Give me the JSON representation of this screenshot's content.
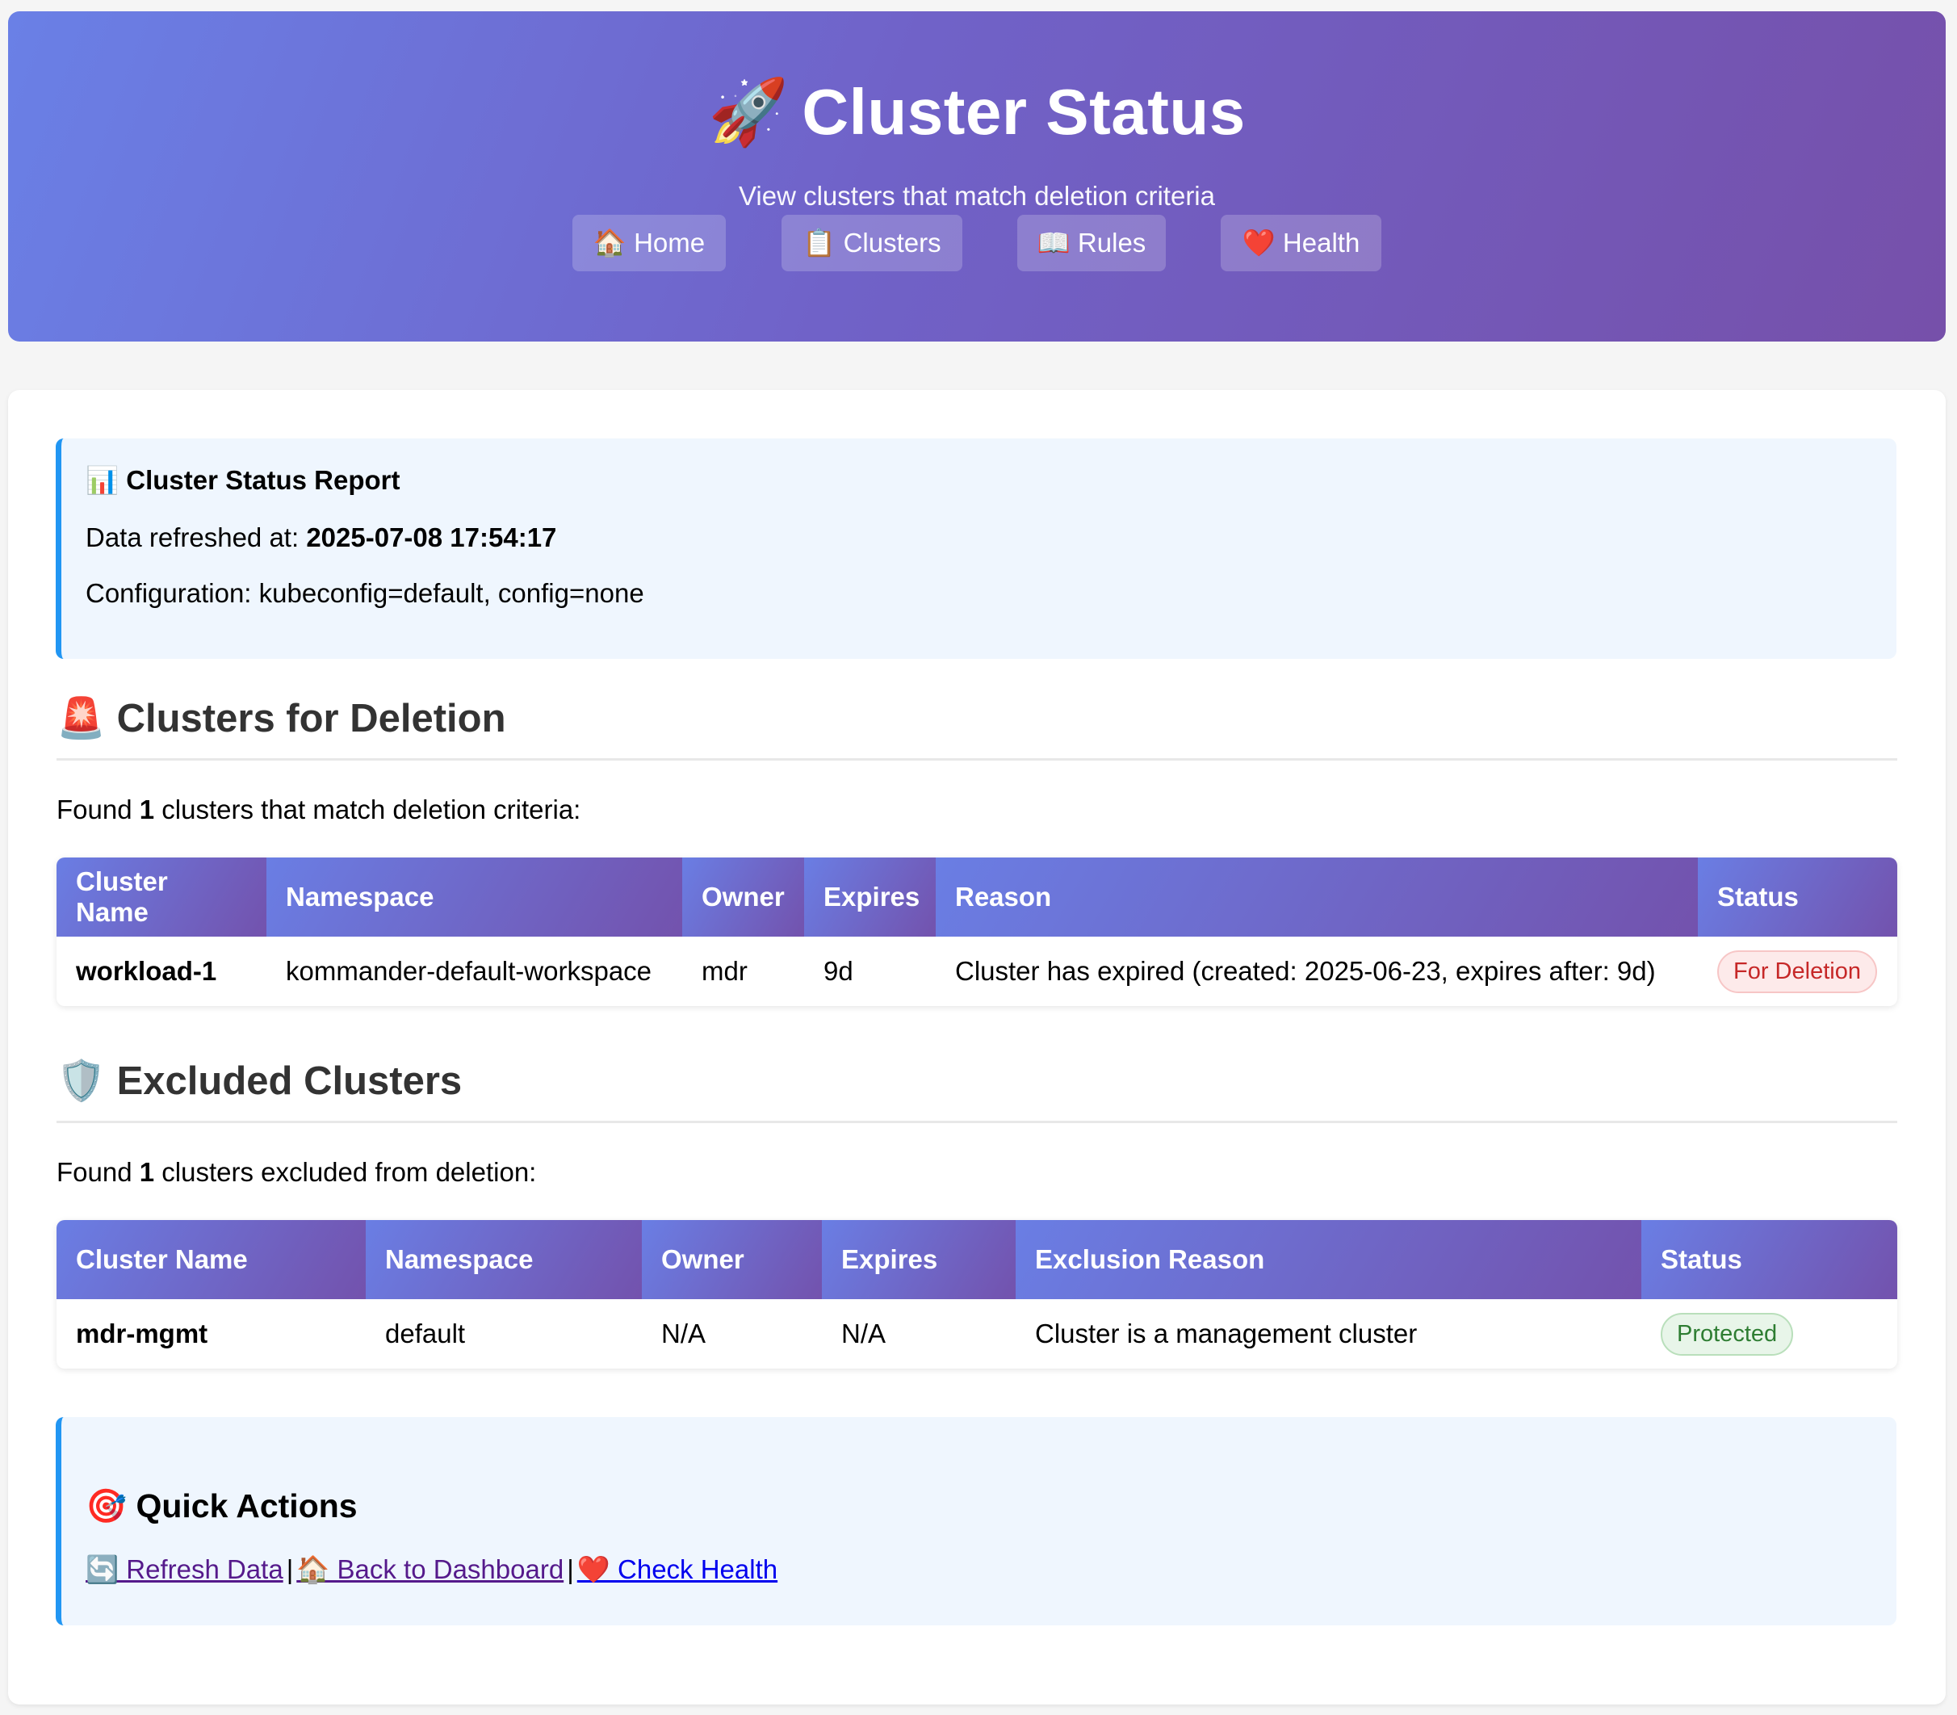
{
  "header": {
    "emoji": "🚀",
    "title": "Cluster Status",
    "subtitle": "View clusters that match deletion criteria",
    "nav": [
      {
        "label": "🏠 Home"
      },
      {
        "label": "📋 Clusters"
      },
      {
        "label": "📖 Rules"
      },
      {
        "label": "❤️ Health"
      }
    ]
  },
  "report": {
    "title": "📊 Cluster Status Report",
    "refreshed_label": "Data refreshed at:",
    "refreshed_value": "2025-07-08 17:54:17",
    "configuration": "Configuration: kubeconfig=default, config=none"
  },
  "deletion": {
    "title": "🚨 Clusters for Deletion",
    "found_prefix": "Found",
    "found_count": "1",
    "found_suffix": "clusters that match deletion criteria:",
    "columns": [
      "Cluster Name",
      "Namespace",
      "Owner",
      "Expires",
      "Reason",
      "Status"
    ],
    "rows": [
      {
        "name": "workload-1",
        "namespace": "kommander-default-workspace",
        "owner": "mdr",
        "expires": "9d",
        "reason": "Cluster has expired (created: 2025-06-23, expires after: 9d)",
        "status": "For Deletion"
      }
    ]
  },
  "excluded": {
    "title": "🛡️ Excluded Clusters",
    "found_prefix": "Found",
    "found_count": "1",
    "found_suffix": "clusters excluded from deletion:",
    "columns": [
      "Cluster Name",
      "Namespace",
      "Owner",
      "Expires",
      "Exclusion Reason",
      "Status"
    ],
    "rows": [
      {
        "name": "mdr-mgmt",
        "namespace": "default",
        "owner": "N/A",
        "expires": "N/A",
        "reason": "Cluster is a management cluster",
        "status": "Protected"
      }
    ]
  },
  "actions": {
    "title": "🎯 Quick Actions",
    "links": [
      {
        "label": "🔄 Refresh Data"
      },
      {
        "label": "🏠 Back to Dashboard"
      },
      {
        "label": "❤️ Check Health"
      }
    ],
    "separator": "|"
  },
  "colors": {
    "header_gradient_start": "#6a80e6",
    "header_gradient_end": "#7650aa",
    "info_border": "#2196f3",
    "info_background": "#eff6fe",
    "deletion_badge": "#c62828",
    "protected_badge": "#2e7d32"
  }
}
